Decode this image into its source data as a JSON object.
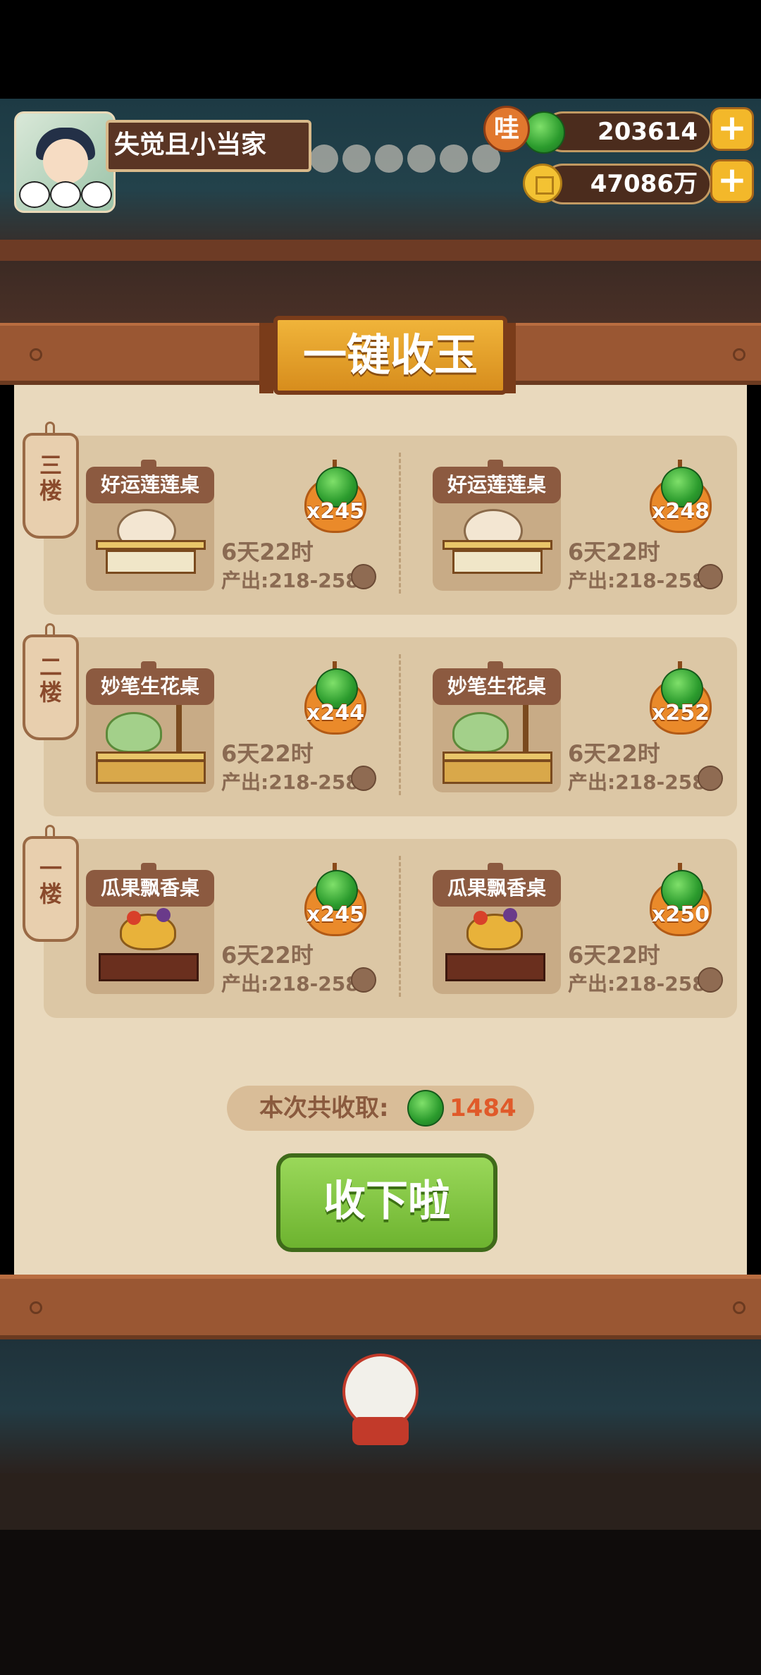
{
  "player": {
    "name": "失觉且小当家"
  },
  "resources": {
    "jade_badge": "哇",
    "jade": "203614",
    "coins": "47086万"
  },
  "panel": {
    "title": "一键收玉",
    "floors": [
      {
        "label": "三楼",
        "tables": [
          {
            "name": "好运莲莲桌",
            "jade": "x245",
            "time": "6天22时",
            "output": "产出:218-258"
          },
          {
            "name": "好运莲莲桌",
            "jade": "x248",
            "time": "6天22时",
            "output": "产出:218-258"
          }
        ]
      },
      {
        "label": "二楼",
        "tables": [
          {
            "name": "妙笔生花桌",
            "jade": "x244",
            "time": "6天22时",
            "output": "产出:218-258"
          },
          {
            "name": "妙笔生花桌",
            "jade": "x252",
            "time": "6天22时",
            "output": "产出:218-258"
          }
        ]
      },
      {
        "label": "一楼",
        "tables": [
          {
            "name": "瓜果飘香桌",
            "jade": "x245",
            "time": "6天22时",
            "output": "产出:218-258"
          },
          {
            "name": "瓜果飘香桌",
            "jade": "x250",
            "time": "6天22时",
            "output": "产出:218-258"
          }
        ]
      }
    ],
    "total_label": "本次共收取:",
    "total_value": "1484",
    "collect_button": "收下啦"
  }
}
